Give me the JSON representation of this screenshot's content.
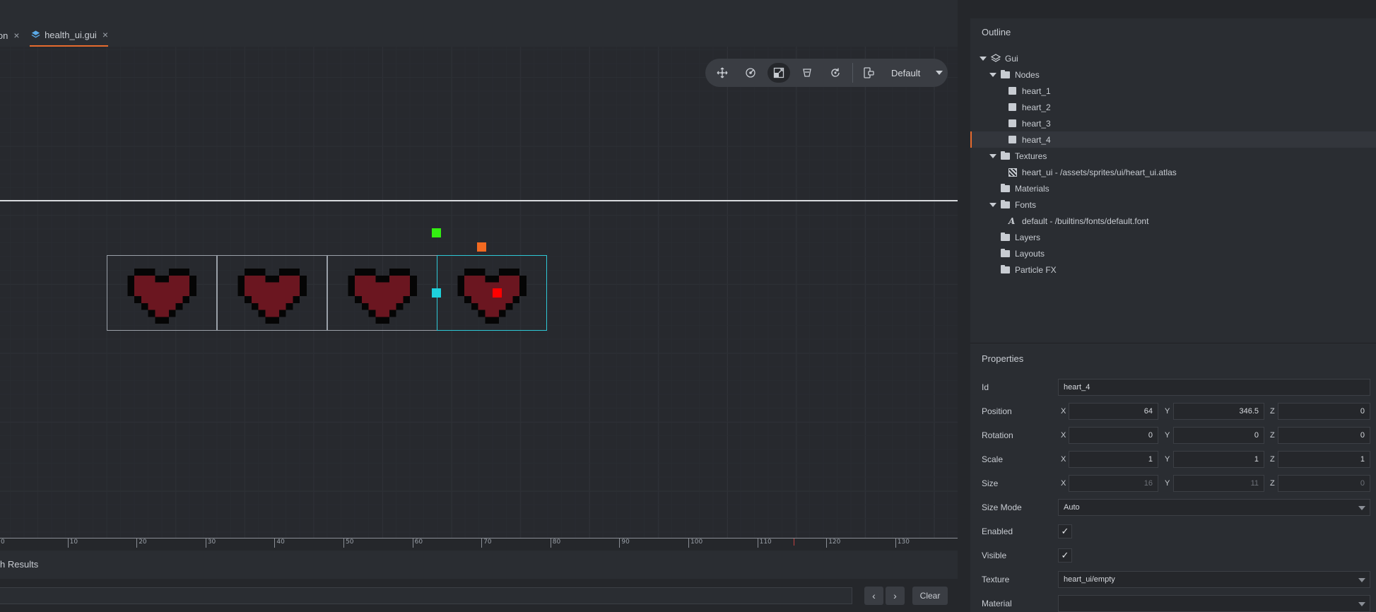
{
  "tabs": {
    "prev": {
      "label": "ion",
      "close": "×"
    },
    "active": {
      "label": "health_ui.gui",
      "close": "×"
    }
  },
  "toolbar": {
    "tools": [
      "move-icon",
      "rotate-icon",
      "scale-icon",
      "anchor-icon",
      "refresh-icon"
    ],
    "layout_icon": "device-icon",
    "layout": "Default"
  },
  "ruler": {
    "ticks": [
      "0",
      "10",
      "20",
      "30",
      "40",
      "50",
      "60",
      "70",
      "80",
      "90",
      "100",
      "110",
      "120",
      "130"
    ]
  },
  "bottom": {
    "title": "h Results",
    "prev": "‹",
    "next": "›",
    "clear": "Clear"
  },
  "outline": {
    "title": "Outline",
    "gui": "Gui",
    "nodes": "Nodes",
    "node_items": [
      "heart_1",
      "heart_2",
      "heart_3",
      "heart_4"
    ],
    "textures": "Textures",
    "texture_item": "heart_ui - /assets/sprites/ui/heart_ui.atlas",
    "materials": "Materials",
    "fonts": "Fonts",
    "font_item": "default - /builtins/fonts/default.font",
    "layers": "Layers",
    "layouts": "Layouts",
    "particlefx": "Particle FX"
  },
  "properties": {
    "title": "Properties",
    "id": {
      "label": "Id",
      "value": "heart_4"
    },
    "position": {
      "label": "Position",
      "x": "64",
      "y": "346.5",
      "z": "0"
    },
    "rotation": {
      "label": "Rotation",
      "x": "0",
      "y": "0",
      "z": "0"
    },
    "scale": {
      "label": "Scale",
      "x": "1",
      "y": "1",
      "z": "1"
    },
    "size": {
      "label": "Size",
      "x": "16",
      "y": "11",
      "z": "0"
    },
    "size_mode": {
      "label": "Size Mode",
      "value": "Auto"
    },
    "enabled": {
      "label": "Enabled",
      "checked": "✓"
    },
    "visible": {
      "label": "Visible",
      "checked": "✓"
    },
    "texture": {
      "label": "Texture",
      "value": "heart_ui/empty"
    },
    "material": {
      "label": "Material",
      "value": ""
    },
    "axis": {
      "x": "X",
      "y": "Y",
      "z": "Z"
    }
  },
  "colors": {
    "accent": "#e66b2e",
    "selection": "#2ec8d6",
    "heart_fill": "#6b1620",
    "heart_outline": "#050505",
    "pivot_red": "#ff0000",
    "handle_green": "#33ee11",
    "handle_orange": "#f26a21",
    "handle_cyan": "#1ed1dc"
  }
}
